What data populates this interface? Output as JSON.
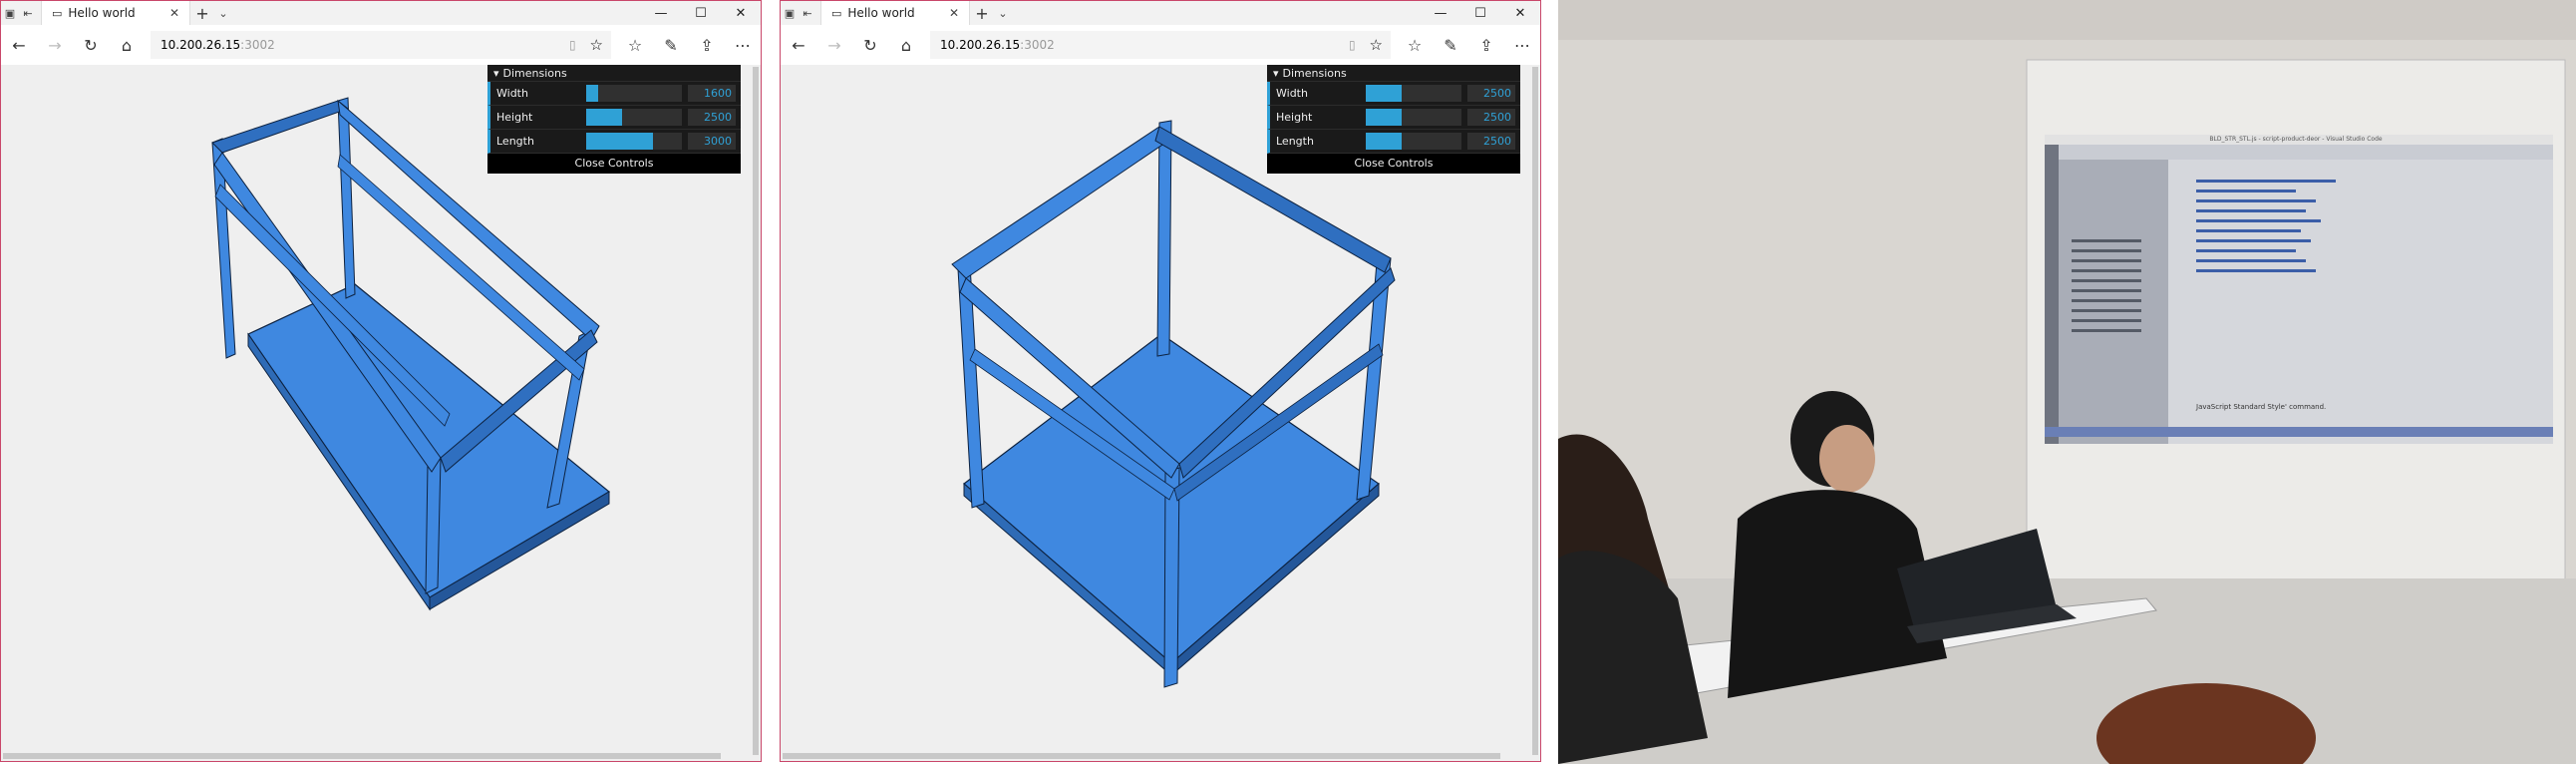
{
  "windows": [
    {
      "tab_title": "Hello world",
      "url_host": "10.200.26.15",
      "url_port": ":3002",
      "controls": {
        "folder_label": "Dimensions",
        "close_label": "Close Controls",
        "rows": [
          {
            "label": "Width",
            "value": "1600",
            "fraction": 0.13
          },
          {
            "label": "Height",
            "value": "2500",
            "fraction": 0.38
          },
          {
            "label": "Length",
            "value": "3000",
            "fraction": 0.7
          }
        ]
      }
    },
    {
      "tab_title": "Hello world",
      "url_host": "10.200.26.15",
      "url_port": ":3002",
      "controls": {
        "folder_label": "Dimensions",
        "close_label": "Close Controls",
        "rows": [
          {
            "label": "Width",
            "value": "2500",
            "fraction": 0.38
          },
          {
            "label": "Height",
            "value": "2500",
            "fraction": 0.38
          },
          {
            "label": "Length",
            "value": "2500",
            "fraction": 0.38
          }
        ]
      }
    }
  ],
  "photo": {
    "projected_title": "BLD_STR_STL.js - script-product-deor - Visual Studio Code",
    "projected_status": "JavaScript Standard Style' command."
  },
  "colors": {
    "model_blue": "#3f88e0",
    "model_dark": "#1d4f8f",
    "gui_accent": "#2fa1d6",
    "window_border": "#c9476a"
  }
}
